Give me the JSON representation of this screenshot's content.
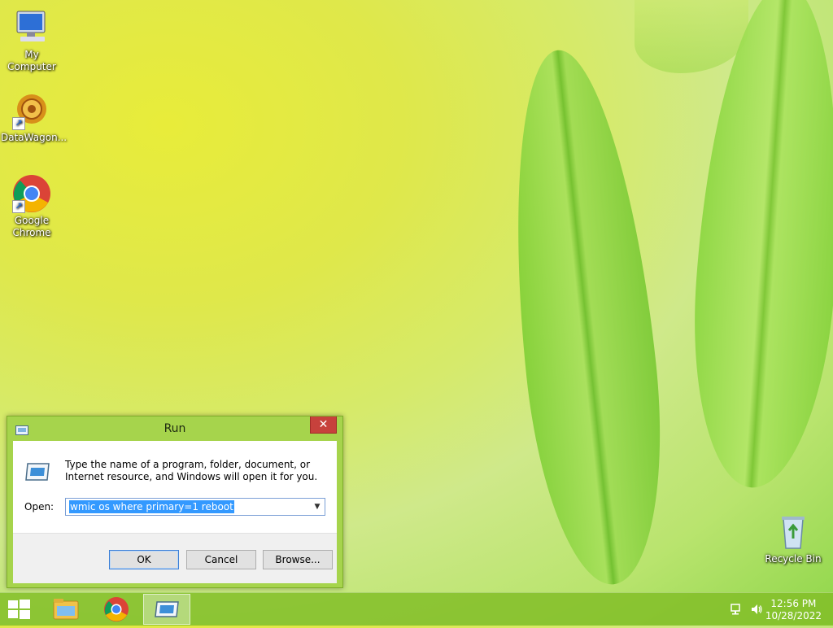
{
  "desktop": {
    "icons": [
      {
        "label": "My Computer"
      },
      {
        "label": "DataWagon..."
      },
      {
        "label": "Google Chrome"
      },
      {
        "label": "Recycle Bin"
      }
    ]
  },
  "run_dialog": {
    "title": "Run",
    "close_glyph": "✕",
    "description": "Type the name of a program, folder, document, or Internet resource, and Windows will open it for you.",
    "open_label": "Open:",
    "open_value": "wmic os where primary=1 reboot",
    "ok_label": "OK",
    "cancel_label": "Cancel",
    "browse_label": "Browse..."
  },
  "taskbar": {
    "items": [
      {
        "icon": "file-explorer-icon"
      },
      {
        "icon": "chrome-icon"
      },
      {
        "icon": "run-icon"
      }
    ],
    "clock": {
      "time": "12:56 PM",
      "date": "10/28/2022"
    }
  },
  "colors": {
    "dialog_frame": "#a6d44c",
    "close_button": "#c7413c",
    "selection": "#3399ff",
    "taskbar": "#82be28"
  }
}
